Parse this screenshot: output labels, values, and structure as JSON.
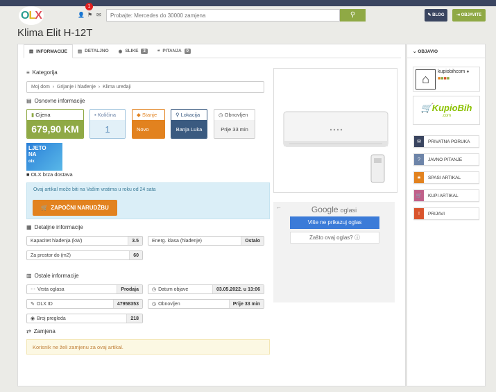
{
  "header": {
    "logo": "OLX",
    "notif_count": "1",
    "search_placeholder": "Probajte: Mercedes do 30000 zamjena",
    "blog": "BLOG",
    "objavite": "OBJAVITE"
  },
  "page_title": "Klima Elit H-12T",
  "tabs": [
    {
      "label": "INFORMACIJE"
    },
    {
      "label": "DETALJNO"
    },
    {
      "label": "SLIKE",
      "count": "3"
    },
    {
      "label": "PITANJA",
      "count": "0"
    }
  ],
  "kategorija": {
    "heading": "Kategorija",
    "crumbs": [
      "Moj dom",
      "Grijanje i hlađenje",
      "Klima uređaji"
    ],
    "sep": "›"
  },
  "osnovne": {
    "heading": "Osnovne informacije",
    "cijena": {
      "label": "Cijena",
      "value": "679,90 KM"
    },
    "kolicina": {
      "label": "Količina",
      "value": "1"
    },
    "stanje": {
      "label": "Stanje",
      "value": "Novo"
    },
    "lokacija": {
      "label": "Lokacija",
      "value": "Banja Luka"
    },
    "obnovljen": {
      "label": "Obnovljen",
      "value": "Prije 33 min"
    }
  },
  "promo": {
    "line1": "LJETO",
    "line2": "NA",
    "badge": "olx"
  },
  "brza_dostava": "OLX brza dostava",
  "delivery": {
    "text": "Ovaj artikal može biti na Vašim vratima u roku od 24 sata",
    "button": "ZAPOČNI NARUDŽBU"
  },
  "detaljne": {
    "heading": "Detaljne informacije",
    "fields": [
      {
        "label": "Kapacitet hlađenja (kW)",
        "value": "3.5"
      },
      {
        "label": "Energ. klasa (hlađenje)",
        "value": "Ostalo"
      },
      {
        "label": "Za prostor do (m2)",
        "value": "60"
      }
    ]
  },
  "ostale": {
    "heading": "Ostale informacije",
    "fields": [
      {
        "label": "Vrsta oglasa",
        "value": "Prodaja"
      },
      {
        "label": "Datum objave",
        "value": "03.05.2022. u 13:06"
      },
      {
        "label": "OLX ID",
        "value": "47958353"
      },
      {
        "label": "Obnovljen",
        "value": "Prije 33 min"
      },
      {
        "label": "Broj pregleda",
        "value": "218"
      }
    ]
  },
  "zamjena": {
    "heading": "Zamjena",
    "text": "Korisnik ne želi zamjenu za ovaj artikal."
  },
  "ad": {
    "google": "Google",
    "oglasi": "oglasi",
    "btn1": "Više ne prikazuj oglas",
    "btn2": "Zašto ovaj oglas?"
  },
  "sidebar": {
    "heading": "OBJAVIO",
    "user": "kupiobihcom",
    "brand": "KupioBih",
    "brand_sub": ".com",
    "actions": [
      {
        "label": "PRIVATNA PORUKA",
        "color": "#3a4560",
        "icon": "✉"
      },
      {
        "label": "JAVNO PITANJE",
        "color": "#6d84a8",
        "icon": "?"
      },
      {
        "label": "SPASI ARTIKAL",
        "color": "#e2821f",
        "icon": "★"
      },
      {
        "label": "KUPI ARTIKAL",
        "color": "#c0608a",
        "icon": "🛒"
      },
      {
        "label": "PRIJAVI",
        "color": "#d9542c",
        "icon": "!"
      }
    ]
  }
}
